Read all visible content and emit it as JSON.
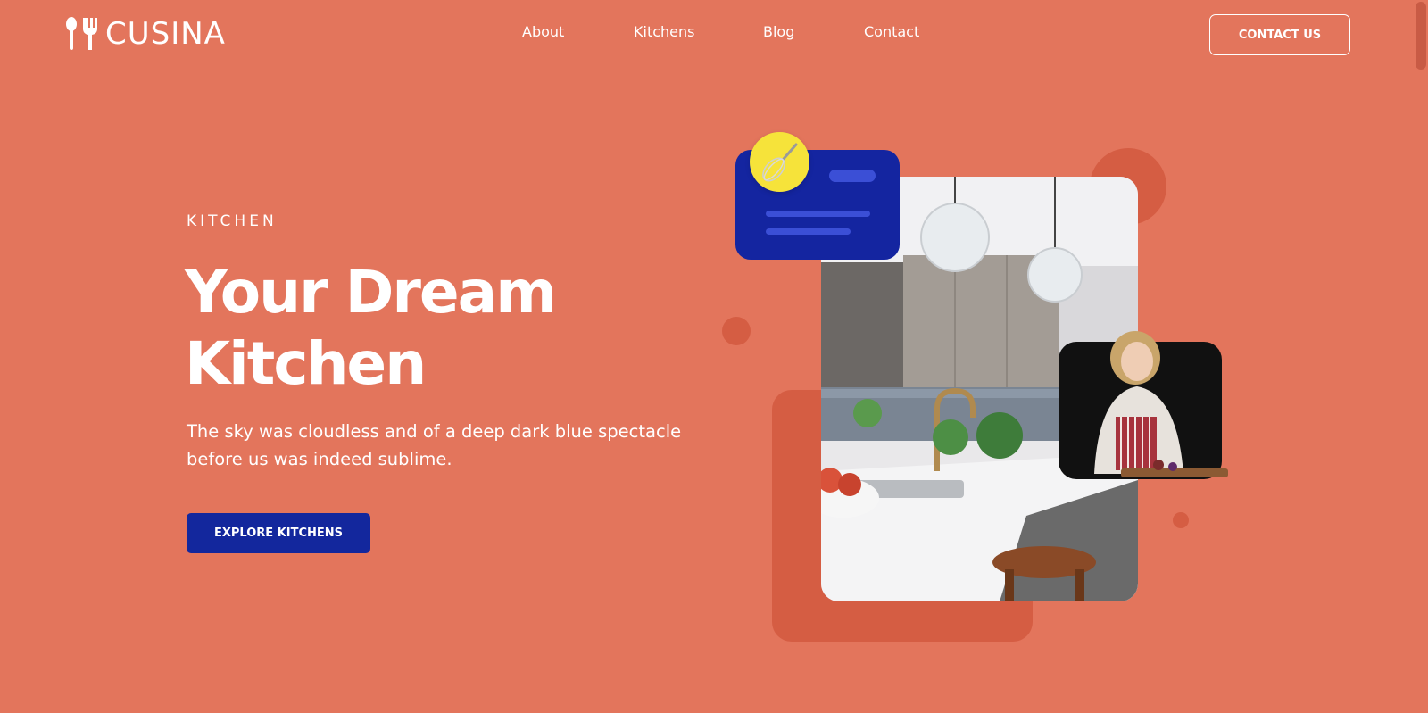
{
  "brand": {
    "name": "CUSINA",
    "icon": "spoon-fork-icon"
  },
  "nav": {
    "items": [
      {
        "label": "About"
      },
      {
        "label": "Kitchens"
      },
      {
        "label": "Blog"
      },
      {
        "label": "Contact"
      }
    ]
  },
  "header": {
    "cta_label": "CONTACT US"
  },
  "hero": {
    "eyebrow": "KITCHEN",
    "headline_line1": "Your Dream",
    "headline_line2": "Kitchen",
    "subtitle": "The sky was cloudless and of a deep dark blue spectacle before us was indeed sublime.",
    "cta_label": "EXPLORE KITCHENS"
  },
  "colors": {
    "background": "#e3755c",
    "accent_dark": "#d55d43",
    "primary_blue": "#13279d",
    "yellow": "#f6e33a"
  },
  "illustration": {
    "kitchen_photo": "kitchen-photo-icon",
    "chef_photo": "woman-chef-icon",
    "whisk": "whisk-icon"
  }
}
